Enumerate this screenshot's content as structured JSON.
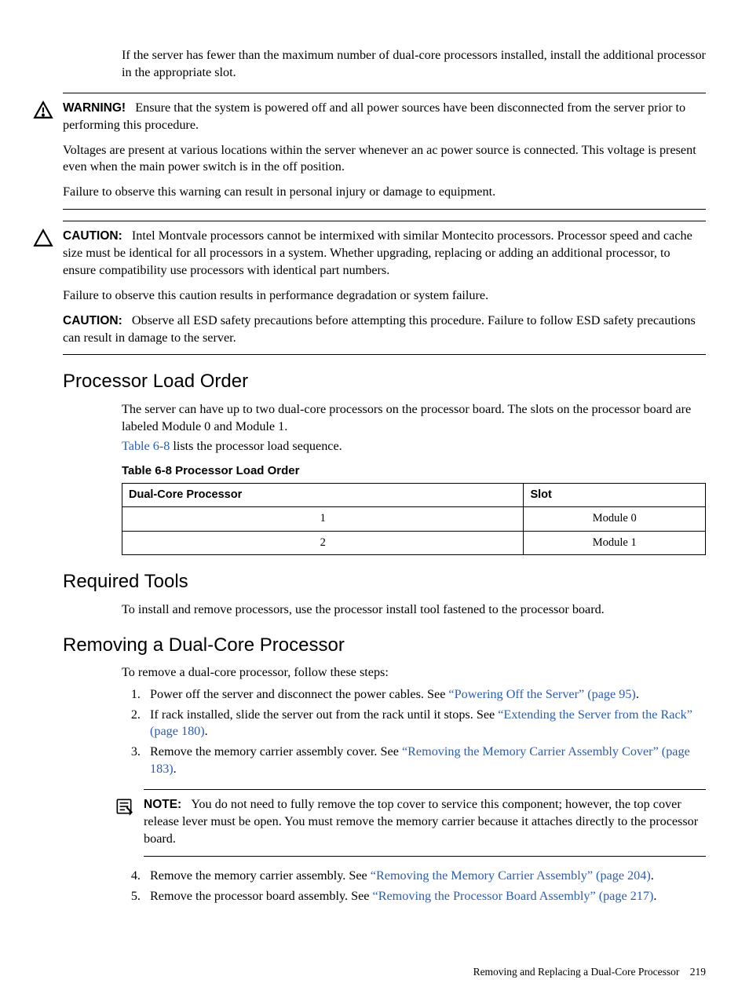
{
  "intro": "If the server has fewer than the maximum number of dual-core processors installed, install the additional processor in the appropriate slot.",
  "warning": {
    "label": "WARNING!",
    "p1": "Ensure that the system is powered off and all power sources have been disconnected from the server prior to performing this procedure.",
    "p2": "Voltages are present at various locations within the server whenever an ac power source is connected. This voltage is present even when the main power switch is in the off position.",
    "p3": "Failure to observe this warning can result in personal injury or damage to equipment."
  },
  "caution": {
    "label1": "CAUTION:",
    "p1": "Intel Montvale processors cannot be intermixed with similar Montecito processors. Processor speed and cache size must be identical for all processors in a system. Whether upgrading, replacing or adding an additional processor, to ensure compatibility use processors with identical part numbers.",
    "p2": "Failure to observe this caution results in performance degradation or system failure.",
    "label2": "CAUTION:",
    "p3": "Observe all ESD safety precautions before attempting this procedure. Failure to follow ESD safety precautions can result in damage to the server."
  },
  "load_order": {
    "heading": "Processor Load Order",
    "intro": "The server can have up to two dual-core processors on the processor board. The slots on the processor board are labeled Module 0 and Module 1.",
    "table_ref": "Table 6-8",
    "table_ref_tail": " lists the processor load sequence.",
    "table_caption": "Table  6-8  Processor Load Order",
    "col1": "Dual-Core Processor",
    "col2": "Slot",
    "rows": [
      {
        "proc": "1",
        "slot": "Module 0"
      },
      {
        "proc": "2",
        "slot": "Module 1"
      }
    ]
  },
  "tools": {
    "heading": "Required Tools",
    "body": "To install and remove processors, use the processor install tool fastened to the processor board."
  },
  "remove": {
    "heading": "Removing a Dual-Core Processor",
    "intro": "To remove a dual-core processor, follow these steps:",
    "step1_a": "Power off the server and disconnect the power cables. See ",
    "step1_link": "“Powering Off the Server” (page 95)",
    "step1_b": ".",
    "step2_a": "If rack installed, slide the server out from the rack until it stops. See ",
    "step2_link": "“Extending the Server from the Rack” (page 180)",
    "step2_b": ".",
    "step3_a": "Remove the memory carrier assembly cover. See ",
    "step3_link": "“Removing the Memory Carrier Assembly Cover” (page 183)",
    "step3_b": ".",
    "note_label": "NOTE:",
    "note_body": "You do not need to fully remove the top cover to service this component; however, the top cover release lever must be open. You must remove the memory carrier because it attaches directly to the processor board.",
    "step4_a": "Remove the memory carrier assembly. See ",
    "step4_link": "“Removing the Memory Carrier Assembly” (page 204)",
    "step4_b": ".",
    "step5_a": "Remove the processor board assembly. See ",
    "step5_link": "“Removing the Processor Board Assembly” (page 217)",
    "step5_b": "."
  },
  "footer": {
    "text": "Removing and Replacing a Dual-Core Processor",
    "page": "219"
  }
}
